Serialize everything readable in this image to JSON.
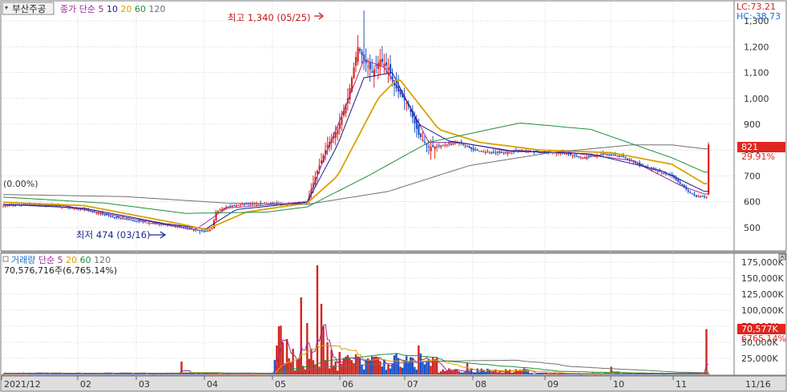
{
  "header": {
    "stock_name": "부산주공",
    "price_legend": [
      {
        "text": "종가 단순",
        "color": "#9a2a9a"
      },
      {
        "text": "5",
        "color": "#9a2a9a"
      },
      {
        "text": "10",
        "color": "#1a1a8c"
      },
      {
        "text": "20",
        "color": "#d9a100"
      },
      {
        "text": "60",
        "color": "#1f8f3a"
      },
      {
        "text": "120",
        "color": "#707070"
      }
    ],
    "lc": "LC:73.21",
    "hc": "HC:-38.73"
  },
  "annotations": {
    "high": "최고 1,340 (05/25)",
    "low": "최저 474 (03/16)",
    "left_percent": "(0.00%)"
  },
  "current": {
    "price": "821",
    "change": "29.91%",
    "volume": "70,577K",
    "volume_ratio": "6765.14%"
  },
  "volume_header": {
    "legend": [
      {
        "text": "거래량",
        "color": "#1c6fd1"
      },
      {
        "text": "단순",
        "color": "#9a2a9a"
      },
      {
        "text": "5",
        "color": "#9a2a9a"
      },
      {
        "text": "20",
        "color": "#d9a100"
      },
      {
        "text": "60",
        "color": "#1f8f3a"
      },
      {
        "text": "120",
        "color": "#707070"
      }
    ],
    "info": "70,576,716주(6,765.14%)"
  },
  "chart_data": [
    {
      "type": "candlestick",
      "y_axis_ticks": [
        500,
        600,
        700,
        800,
        900,
        1000,
        1100,
        1200,
        1300
      ],
      "y_axis_tick_labels": [
        "500",
        "600",
        "700",
        "800",
        "900",
        "1,000",
        "1,100",
        "1,200",
        "1,300"
      ],
      "ylim": [
        420,
        1350
      ],
      "x_labels": [
        "2021/12",
        "02",
        "03",
        "04",
        "05",
        "06",
        "07",
        "08",
        "09",
        "10",
        "11"
      ],
      "x_end_label": "11/16",
      "high": {
        "value": 1340,
        "date": "05/25"
      },
      "low": {
        "value": 474,
        "date": "03/16"
      },
      "close_path": [
        [
          0,
          585
        ],
        [
          12,
          590
        ],
        [
          25,
          585
        ],
        [
          40,
          570
        ],
        [
          55,
          540
        ],
        [
          70,
          520
        ],
        [
          85,
          505
        ],
        [
          95,
          490
        ],
        [
          100,
          485
        ],
        [
          103,
          495
        ],
        [
          105,
          560
        ],
        [
          110,
          580
        ],
        [
          118,
          590
        ],
        [
          130,
          595
        ],
        [
          140,
          592
        ],
        [
          150,
          600
        ],
        [
          155,
          720
        ],
        [
          160,
          820
        ],
        [
          165,
          880
        ],
        [
          170,
          1000
        ],
        [
          175,
          1200
        ],
        [
          178,
          1150
        ],
        [
          182,
          1100
        ],
        [
          186,
          1150
        ],
        [
          190,
          1120
        ],
        [
          193,
          1050
        ],
        [
          200,
          970
        ],
        [
          205,
          860
        ],
        [
          210,
          810
        ],
        [
          218,
          820
        ],
        [
          225,
          830
        ],
        [
          232,
          800
        ],
        [
          240,
          790
        ],
        [
          248,
          790
        ],
        [
          256,
          800
        ],
        [
          266,
          790
        ],
        [
          276,
          790
        ],
        [
          286,
          770
        ],
        [
          296,
          785
        ],
        [
          306,
          775
        ],
        [
          315,
          740
        ],
        [
          322,
          720
        ],
        [
          330,
          700
        ],
        [
          338,
          640
        ],
        [
          342,
          620
        ],
        [
          347,
          620
        ],
        [
          348,
          821
        ]
      ],
      "ma_series": [
        {
          "legend": "5",
          "color": "#9a2a9a",
          "path": [
            [
              0,
              588
            ],
            [
              30,
              585
            ],
            [
              60,
              540
            ],
            [
              95,
              492
            ],
            [
              110,
              575
            ],
            [
              150,
              600
            ],
            [
              160,
              800
            ],
            [
              170,
              990
            ],
            [
              178,
              1150
            ],
            [
              188,
              1120
            ],
            [
              200,
              980
            ],
            [
              210,
              830
            ],
            [
              225,
              830
            ],
            [
              250,
              795
            ],
            [
              280,
              790
            ],
            [
              310,
              760
            ],
            [
              335,
              660
            ],
            [
              346,
              630
            ]
          ]
        },
        {
          "legend": "10",
          "color": "#1a1a8c",
          "path": [
            [
              0,
              590
            ],
            [
              40,
              575
            ],
            [
              80,
              515
            ],
            [
              100,
              495
            ],
            [
              115,
              570
            ],
            [
              150,
              598
            ],
            [
              165,
              820
            ],
            [
              178,
              1080
            ],
            [
              192,
              1100
            ],
            [
              205,
              900
            ],
            [
              220,
              835
            ],
            [
              250,
              798
            ],
            [
              290,
              785
            ],
            [
              325,
              720
            ],
            [
              346,
              640
            ]
          ]
        },
        {
          "legend": "20",
          "color": "#d9a100",
          "path": [
            [
              0,
              598
            ],
            [
              40,
              585
            ],
            [
              90,
              510
            ],
            [
              100,
              492
            ],
            [
              120,
              560
            ],
            [
              150,
              595
            ],
            [
              165,
              700
            ],
            [
              185,
              1000
            ],
            [
              195,
              1080
            ],
            [
              215,
              880
            ],
            [
              235,
              830
            ],
            [
              265,
              800
            ],
            [
              300,
              790
            ],
            [
              330,
              745
            ],
            [
              346,
              670
            ]
          ]
        },
        {
          "legend": "60",
          "color": "#1f8f3a",
          "path": [
            [
              0,
              618
            ],
            [
              50,
              595
            ],
            [
              90,
              555
            ],
            [
              130,
              560
            ],
            [
              150,
              580
            ],
            [
              180,
              700
            ],
            [
              210,
              830
            ],
            [
              240,
              880
            ],
            [
              255,
              905
            ],
            [
              290,
              880
            ],
            [
              330,
              770
            ],
            [
              346,
              715
            ]
          ]
        },
        {
          "legend": "120",
          "color": "#707070",
          "path": [
            [
              0,
              628
            ],
            [
              60,
              620
            ],
            [
              110,
              595
            ],
            [
              150,
              590
            ],
            [
              190,
              640
            ],
            [
              230,
              740
            ],
            [
              270,
              790
            ],
            [
              310,
              820
            ],
            [
              330,
              820
            ],
            [
              346,
              805
            ]
          ]
        }
      ]
    },
    {
      "type": "bar",
      "name": "거래량",
      "y_axis_ticks": [
        25000,
        50000,
        75000,
        100000,
        125000,
        150000,
        175000
      ],
      "y_axis_tick_labels": [
        "25,000K",
        "50,000K",
        "75,000K",
        "100,000K",
        "125,000K",
        "150,000K",
        "175,000K"
      ],
      "ylim": [
        0,
        185000
      ],
      "unit": "K",
      "volumes_approx": [
        [
          88,
          20000
        ],
        [
          135,
          45000
        ],
        [
          136,
          75000
        ],
        [
          137,
          76000
        ],
        [
          138,
          50000
        ],
        [
          140,
          55000
        ],
        [
          143,
          40000
        ],
        [
          147,
          120000
        ],
        [
          150,
          80000
        ],
        [
          152,
          40000
        ],
        [
          155,
          170000
        ],
        [
          157,
          110000
        ],
        [
          158,
          75000
        ],
        [
          160,
          50000
        ],
        [
          162,
          38000
        ],
        [
          166,
          35000
        ],
        [
          170,
          30000
        ],
        [
          175,
          28000
        ],
        [
          180,
          25000
        ],
        [
          190,
          15000
        ],
        [
          196,
          12000
        ],
        [
          205,
          45000
        ],
        [
          229,
          18000
        ],
        [
          300,
          12000
        ],
        [
          347,
          70577
        ]
      ]
    }
  ]
}
